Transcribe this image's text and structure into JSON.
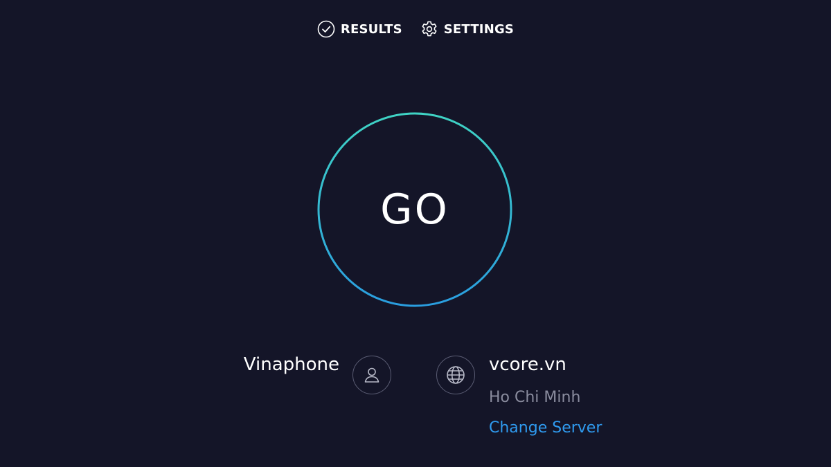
{
  "nav": {
    "results_label": "RESULTS",
    "settings_label": "SETTINGS"
  },
  "go_button": {
    "label": "GO",
    "ring_colors": [
      "#3fd3c4",
      "#2a9ee0"
    ]
  },
  "isp": {
    "name": "Vinaphone",
    "icon": "user-icon"
  },
  "server": {
    "host": "vcore.vn",
    "location": "Ho Chi Minh",
    "change_label": "Change Server",
    "icon": "globe-icon"
  },
  "colors": {
    "background": "#141528",
    "link": "#2f9bf0",
    "muted_text": "#8a8c9e"
  }
}
